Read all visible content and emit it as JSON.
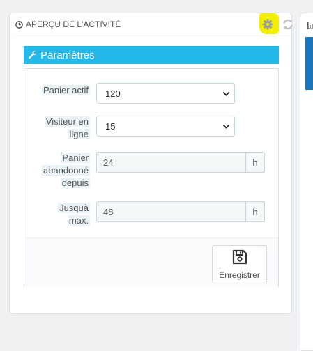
{
  "panel": {
    "title": "APERÇU DE L'ACTIVITÉ",
    "highlight_color": "#f4ef00",
    "icons": [
      "clock-icon",
      "gear-icon",
      "refresh-icon"
    ]
  },
  "config": {
    "title": "Paramètres",
    "accent_color": "#24b9e8",
    "fields": {
      "active_cart": {
        "label_line1": "Panier actif",
        "value": "120"
      },
      "online_visitor": {
        "label_line1": "Visiteur en",
        "label_line2": "ligne",
        "value": "15"
      },
      "abandoned_cart_min": {
        "label_line1": "Panier",
        "label_line2": "abandonné",
        "label_line3": "depuis",
        "value": "24",
        "unit": "h"
      },
      "abandoned_cart_max": {
        "label_line1": "Jusquà",
        "label_line2": "max.",
        "value": "48",
        "unit": "h"
      }
    },
    "save_label": "Enregistrer"
  },
  "right_panel": {
    "accent_color": "#1b75b7"
  }
}
